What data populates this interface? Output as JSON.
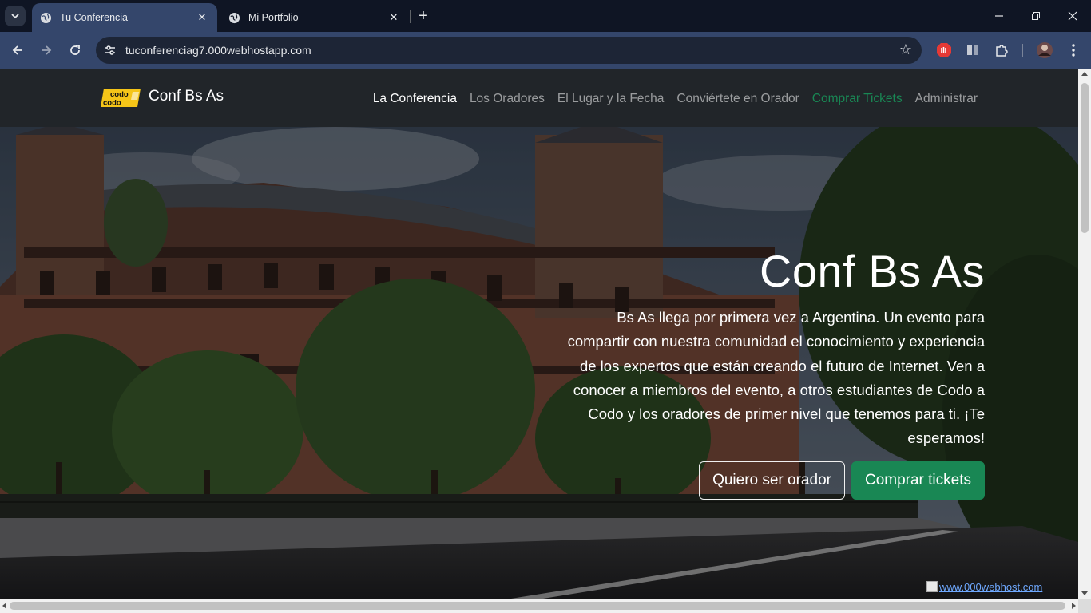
{
  "browser": {
    "tabs": [
      {
        "title": "Tu Conferencia",
        "active": true
      },
      {
        "title": "Mi Portfolio",
        "active": false
      }
    ],
    "url": "tuconferenciag7.000webhostapp.com",
    "icons": {
      "tab_search": "chevron-down-icon",
      "new_tab": "plus-icon",
      "back": "arrow-left-icon",
      "forward": "arrow-right-icon",
      "reload": "reload-icon",
      "site_info": "tune-icon",
      "bookmark": "star-icon",
      "extensions": [
        "adblock-icon",
        "reader-mode-icon",
        "puzzle-icon"
      ],
      "profile": "avatar-icon"
    }
  },
  "site": {
    "brand": {
      "logo_top": "codo",
      "logo_bottom": "codo",
      "name": "Conf Bs As"
    },
    "nav": [
      {
        "label": "La Conferencia",
        "state": "active"
      },
      {
        "label": "Los Oradores",
        "state": "normal"
      },
      {
        "label": "El Lugar y la Fecha",
        "state": "normal"
      },
      {
        "label": "Conviértete en Orador",
        "state": "normal"
      },
      {
        "label": "Comprar Tickets",
        "state": "highlight"
      },
      {
        "label": "Administrar",
        "state": "normal"
      }
    ],
    "hero": {
      "title": "Conf Bs As",
      "text": "Bs As llega por primera vez a Argentina. Un evento para compartir con nuestra comunidad el conocimiento y experiencia de los expertos que están creando el futuro de Internet. Ven a conocer a miembros del evento, a otros estudiantes de Codo a Codo y los oradores de primer nivel que tenemos para ti. ¡Te esperamos!",
      "btn_speaker": "Quiero ser orador",
      "btn_tickets": "Comprar tickets"
    },
    "host_badge": "www.000webhost.com"
  },
  "colors": {
    "navbar_bg": "#212529",
    "accent_green": "#198754",
    "tab_active": "#34466b",
    "tabstrip_bg": "#0f1524"
  }
}
